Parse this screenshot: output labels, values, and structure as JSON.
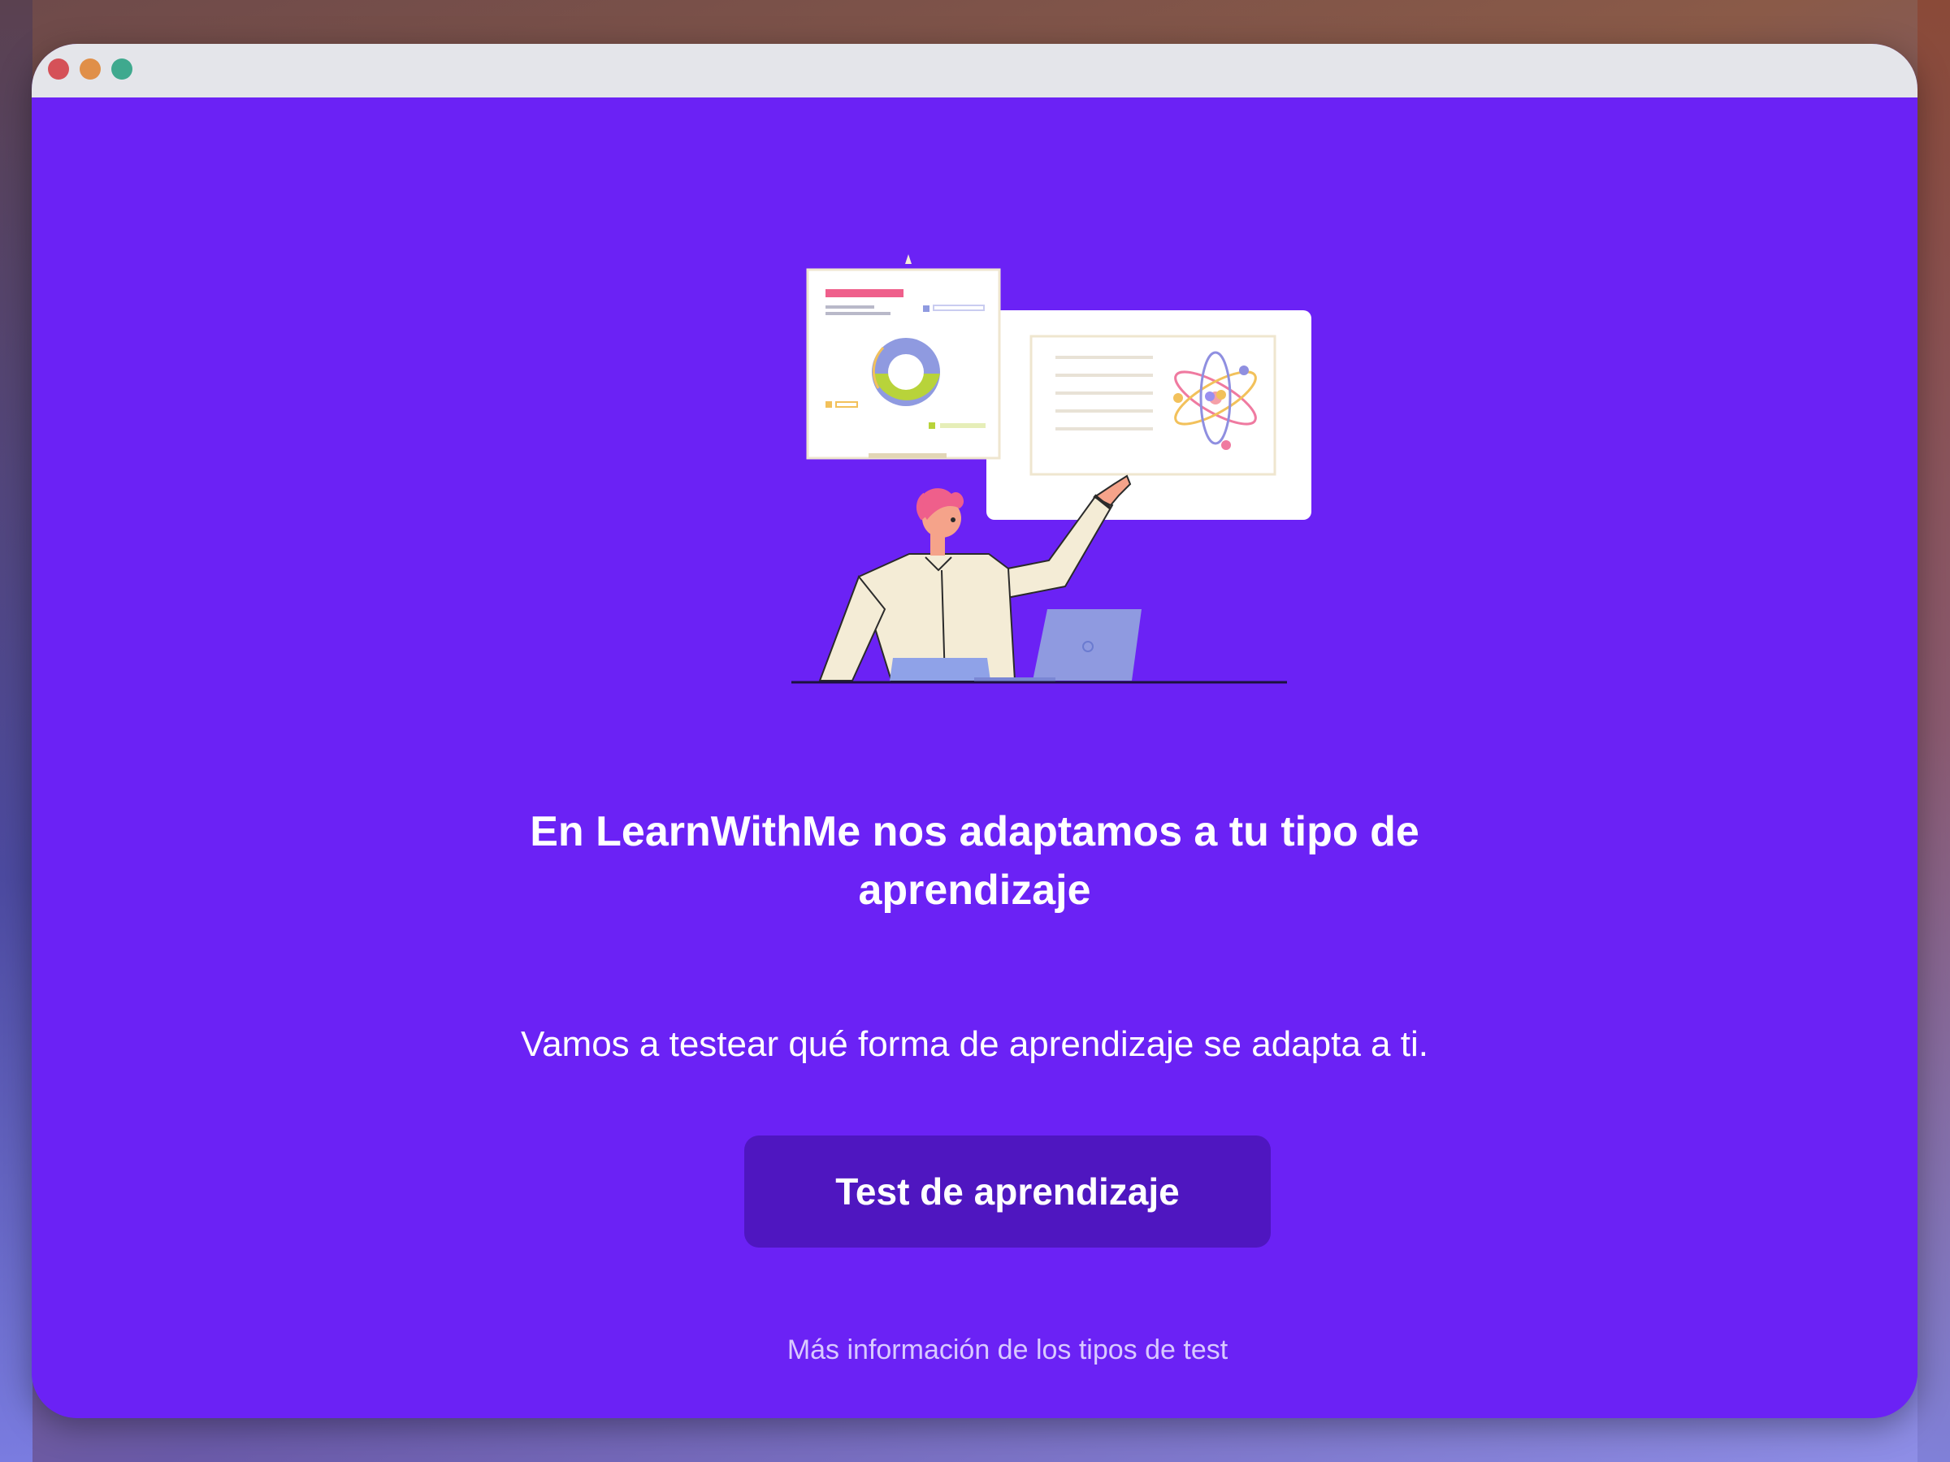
{
  "window": {
    "controls": [
      "close",
      "minimize",
      "maximize"
    ]
  },
  "colors": {
    "background": "#6b22f5",
    "button": "#4f16c0",
    "titlebar": "#e4e5ea",
    "link": "#d9c9ff"
  },
  "hero": {
    "illustration_icon": "teacher-presenting-illustration"
  },
  "main": {
    "headline": "En LearnWithMe nos adaptamos a tu tipo de aprendizaje",
    "subtitle": "Vamos a testear qué forma de aprendizaje se adapta a ti.",
    "cta_label": "Test de aprendizaje",
    "more_info_link": "Más información de los tipos de test"
  }
}
